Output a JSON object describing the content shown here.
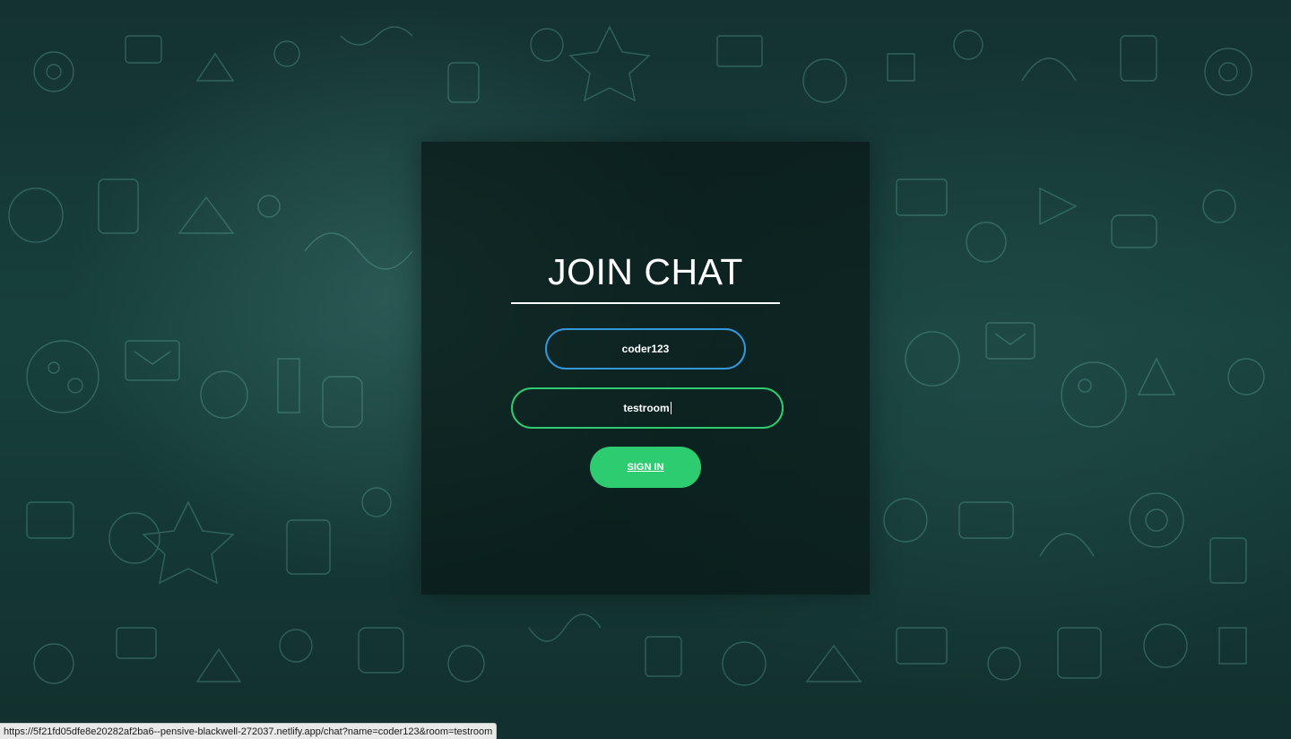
{
  "page": {
    "title": "JOIN CHAT"
  },
  "form": {
    "name_value": "coder123",
    "room_value": "testroom",
    "submit_label": "SIGN IN"
  },
  "status_bar": {
    "url": "https://5f21fd05dfe8e20282af2ba6--pensive-blackwell-272037.netlify.app/chat?name=coder123&room=testroom"
  },
  "colors": {
    "name_border": "#3498db",
    "room_border": "#2ecc71",
    "button_bg": "#2ecc71",
    "background": "#143230"
  }
}
